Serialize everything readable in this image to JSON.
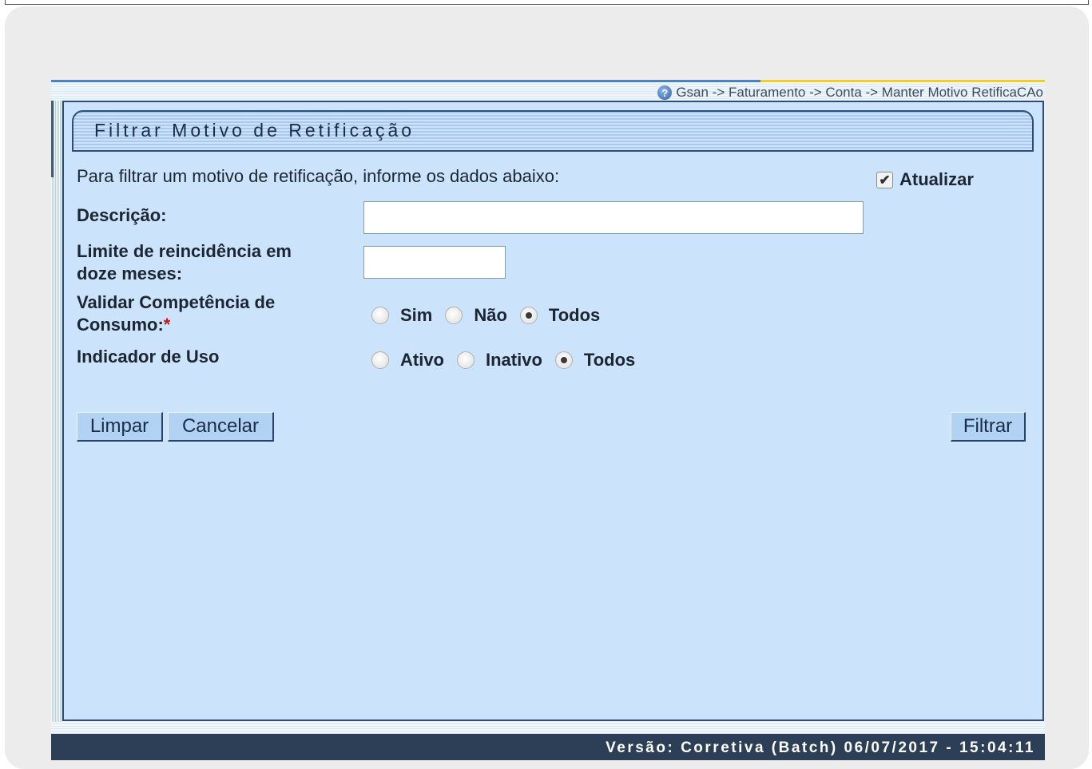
{
  "breadcrumb": "Gsan -> Faturamento -> Conta -> Manter Motivo RetificaCAo",
  "title": "Filtrar Motivo de Retificação",
  "intro_text": "Para filtrar um motivo de retificação, informe os dados abaixo:",
  "atualizar": {
    "label": "Atualizar",
    "checked": true
  },
  "descricao": {
    "label": "Descrição:",
    "value": ""
  },
  "limite": {
    "label_line1": "Limite de reincidência em",
    "label_line2": "doze meses:",
    "value": ""
  },
  "validar": {
    "label_line1": "Validar Competência de",
    "label_line2": "Consumo:",
    "required_mark": "*",
    "options": [
      "Sim",
      "Não",
      "Todos"
    ],
    "selected": "Todos"
  },
  "indicador": {
    "label": "Indicador de Uso",
    "options": [
      "Ativo",
      "Inativo",
      "Todos"
    ],
    "selected": "Todos"
  },
  "buttons": {
    "limpar": "Limpar",
    "cancelar": "Cancelar",
    "filtrar": "Filtrar"
  },
  "footer_version": "Versão: Corretiva (Batch) 06/07/2017 - 15:04:11"
}
